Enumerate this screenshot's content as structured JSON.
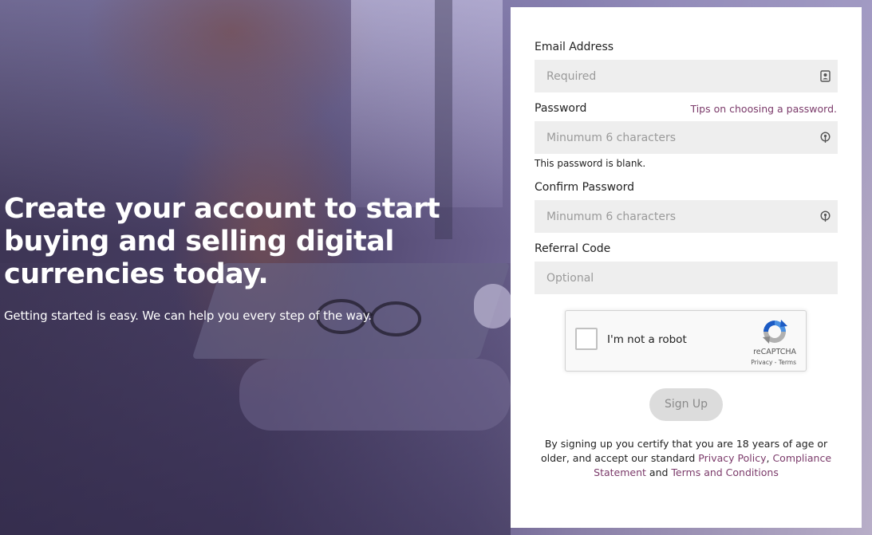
{
  "hero": {
    "title": "Create your account to start buying and selling digital currencies today.",
    "subtitle": "Getting started is easy. We can help you every step of the way."
  },
  "form": {
    "email": {
      "label": "Email Address",
      "placeholder": "Required",
      "value": "",
      "icon": "contact-card-icon"
    },
    "password": {
      "label": "Password",
      "tip_link": "Tips on choosing a password.",
      "placeholder": "Minumum 6 characters",
      "value": "",
      "icon": "lock-icon",
      "error": "This password is blank."
    },
    "confirm_password": {
      "label": "Confirm Password",
      "placeholder": "Minumum 6 characters",
      "value": "",
      "icon": "lock-icon"
    },
    "referral": {
      "label": "Referral Code",
      "placeholder": "Optional",
      "value": ""
    },
    "captcha": {
      "label": "I'm not a robot",
      "brand": "reCAPTCHA",
      "privacy_link": "Privacy",
      "separator": "-",
      "terms_link": "Terms"
    },
    "signup_label": "Sign Up",
    "disclaimer": {
      "text_before": "By signing up you certify that you are 18 years of age or older, and accept our standard ",
      "privacy_link": "Privacy Policy",
      "comma": ", ",
      "compliance_link": "Compliance Statement",
      "and": " and ",
      "terms_link": "Terms and Conditions"
    }
  },
  "colors": {
    "link": "#7b3a6a",
    "field_bg": "#eeeeee",
    "button_disabled_bg": "#dcdcdc"
  }
}
